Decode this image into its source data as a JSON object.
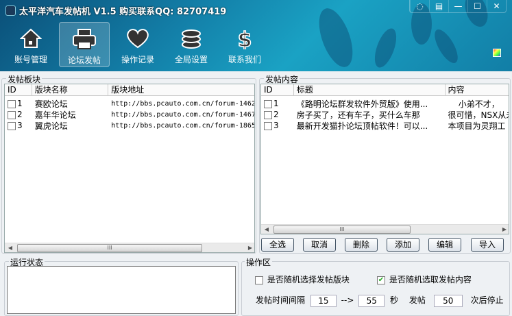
{
  "window": {
    "title": "太平洋汽车发帖机 V1.5 购买联系QQ: 82707419",
    "controls": [
      "◌",
      "▤",
      "—",
      "☐",
      "✕"
    ]
  },
  "nav": [
    {
      "label": "账号管理",
      "icon": "home-icon"
    },
    {
      "label": "论坛发帖",
      "icon": "printer-icon",
      "active": true
    },
    {
      "label": "操作记录",
      "icon": "heart-icon"
    },
    {
      "label": "全局设置",
      "icon": "database-icon"
    },
    {
      "label": "联系我们",
      "icon": "dollar-icon"
    }
  ],
  "boards": {
    "title": "发帖板块",
    "columns": [
      "ID",
      "版块名称",
      "版块地址"
    ],
    "rows": [
      {
        "id": "1",
        "name": "赛欧论坛",
        "url": "http://bbs.pcauto.com.cn/forum-1462",
        "checked": false
      },
      {
        "id": "2",
        "name": "嘉年华论坛",
        "url": "http://bbs.pcauto.com.cn/forum-1467",
        "checked": false
      },
      {
        "id": "3",
        "name": "翼虎论坛",
        "url": "http://bbs.pcauto.com.cn/forum-1865",
        "checked": false
      }
    ]
  },
  "content": {
    "title": "发帖内容",
    "columns": [
      "ID",
      "标题",
      "内容"
    ],
    "rows": [
      {
        "id": "1",
        "title": "《路明论坛群发软件外贸版》使用...",
        "body": "    小弟不才，",
        "checked": false
      },
      {
        "id": "2",
        "title": "房子买了，还有车子，买什么车那",
        "body": "很可惜，NSX从未",
        "checked": false
      },
      {
        "id": "3",
        "title": "最新开发猫扑论坛顶帖软件！可以...",
        "body": "本项目为灵翔工",
        "checked": false
      }
    ],
    "buttons": [
      "全选",
      "取消",
      "删除",
      "添加",
      "编辑",
      "导入"
    ]
  },
  "status": {
    "title": "运行状态",
    "log": ""
  },
  "ops": {
    "title": "操作区",
    "random_board": {
      "label": "是否随机选择发帖版块",
      "checked": false
    },
    "random_content": {
      "label": "是否随机选取发帖内容",
      "checked": true
    },
    "interval_label": "发帖时间间隔",
    "interval_min": "15",
    "arrow": "-->",
    "interval_max": "55",
    "sec": "秒",
    "post_label": "发帖",
    "post_count": "50",
    "stop_label": "次后停止"
  }
}
